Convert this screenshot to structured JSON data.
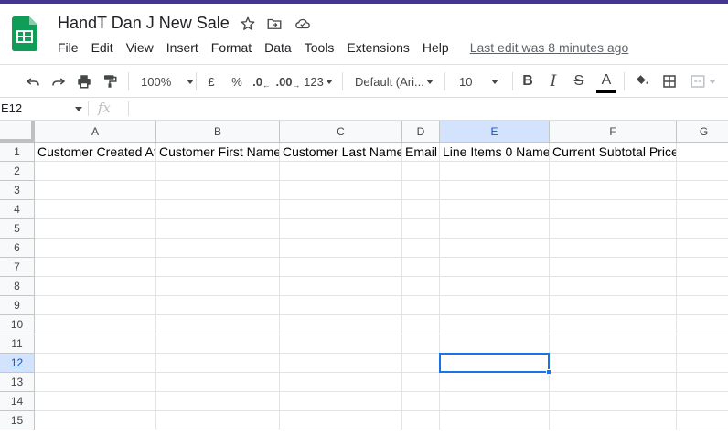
{
  "app": {
    "doc_title": "HandT Dan J New Sale",
    "accent_color": "#473592",
    "brand_color": "#0f9d58",
    "icons": [
      "star-icon",
      "move-to-folder-icon",
      "cloud-status-icon"
    ]
  },
  "menu": {
    "items": [
      "File",
      "Edit",
      "View",
      "Insert",
      "Format",
      "Data",
      "Tools",
      "Extensions",
      "Help"
    ],
    "last_edit": "Last edit was 8 minutes ago"
  },
  "toolbar": {
    "zoom": "100%",
    "currency": "£",
    "percent": "%",
    "decrease_decimal": ".0",
    "increase_decimal": ".00",
    "more_formats": "123",
    "font": "Default (Ari...",
    "font_size": "10",
    "bold": "B",
    "italic": "I",
    "strike": "S",
    "text_color": "A"
  },
  "formula_bar": {
    "name_box": "E12",
    "fx": "fx",
    "content": ""
  },
  "sheet": {
    "selection_color": "#1a73e8",
    "active_cell": "E12",
    "columns": [
      "A",
      "B",
      "C",
      "D",
      "E",
      "F",
      "G"
    ],
    "rows": [
      "1",
      "2",
      "3",
      "4",
      "5",
      "6",
      "7",
      "8",
      "9",
      "10",
      "11",
      "12",
      "13",
      "14",
      "15"
    ],
    "header_row": [
      "Customer Created At",
      "Customer First Name",
      "Customer Last Name",
      "Email",
      "Line Items 0 Name",
      "Current Subtotal Price",
      ""
    ]
  }
}
